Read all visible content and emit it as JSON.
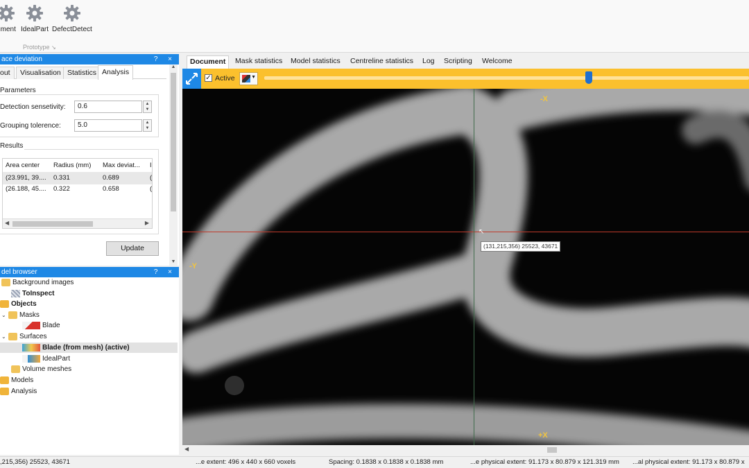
{
  "ribbon": {
    "buttons": [
      {
        "label": "gment",
        "icon": "gear-icon"
      },
      {
        "label": "IdealPart",
        "icon": "gear-icon"
      },
      {
        "label": "DefectDetect",
        "icon": "gear-icon"
      }
    ],
    "group_label": "Prototype",
    "group_arrow": "↘"
  },
  "deviation_panel": {
    "title": "ace deviation",
    "controls": "? ×",
    "tabs": [
      "out",
      "Visualisation",
      "Statistics",
      "Analysis"
    ],
    "active_tab": "Analysis",
    "parameters": {
      "title": "Parameters",
      "detection_label": "Detection sensetivity:",
      "detection_value": "0.6",
      "grouping_label": "Grouping tolerence:",
      "grouping_value": "5.0"
    },
    "results": {
      "title": "Results",
      "columns": [
        "Area center",
        "Radius (mm)",
        "Max deviat...",
        "I"
      ],
      "rows": [
        [
          "(23.991, 39....",
          "0.331",
          "0.689",
          "("
        ],
        [
          "(26.188, 45....",
          "0.322",
          "0.658",
          "("
        ]
      ]
    },
    "update_label": "Update"
  },
  "model_browser": {
    "title": "del browser",
    "controls": "? ×",
    "items": [
      {
        "label": "Background images"
      },
      {
        "label": "ToInspect"
      },
      {
        "label": "Objects"
      },
      {
        "label": "Masks"
      },
      {
        "label": "Blade"
      },
      {
        "label": "Surfaces"
      },
      {
        "label": "Blade (from mesh) (active)"
      },
      {
        "label": "IdealPart"
      },
      {
        "label": "Volume meshes"
      },
      {
        "label": "Models"
      },
      {
        "label": "Analysis"
      }
    ]
  },
  "document_tabs": [
    "Document",
    "Mask statistics",
    "Model statistics",
    "Centreline statistics",
    "Log",
    "Scripting",
    "Welcome"
  ],
  "viewer": {
    "active_label": "Active",
    "active_checked": true,
    "slice_position_fraction": 0.67,
    "axis_top": "-X",
    "axis_bottom": "+X",
    "axis_left": "-Y",
    "coordinate_tooltip": "(131,215,356) 25523, 43671",
    "colors": {
      "toolbar": "#fbc02d",
      "accent": "#1e88e5",
      "crosshair_h": "#c0392b",
      "crosshair_v": "#3f6b4a",
      "axis_label": "#f2c53d"
    }
  },
  "status_bar": {
    "coords": ",215,356) 25523, 43671",
    "extent": "...e extent: 496 x 440 x 660 voxels",
    "spacing": "Spacing: 0.1838 x 0.1838 x 0.1838 mm",
    "physical_extent": "...e physical extent: 91.173 x 80.879 x 121.319 mm",
    "global_extent": "...al physical extent: 91.173 x 80.879 x"
  }
}
